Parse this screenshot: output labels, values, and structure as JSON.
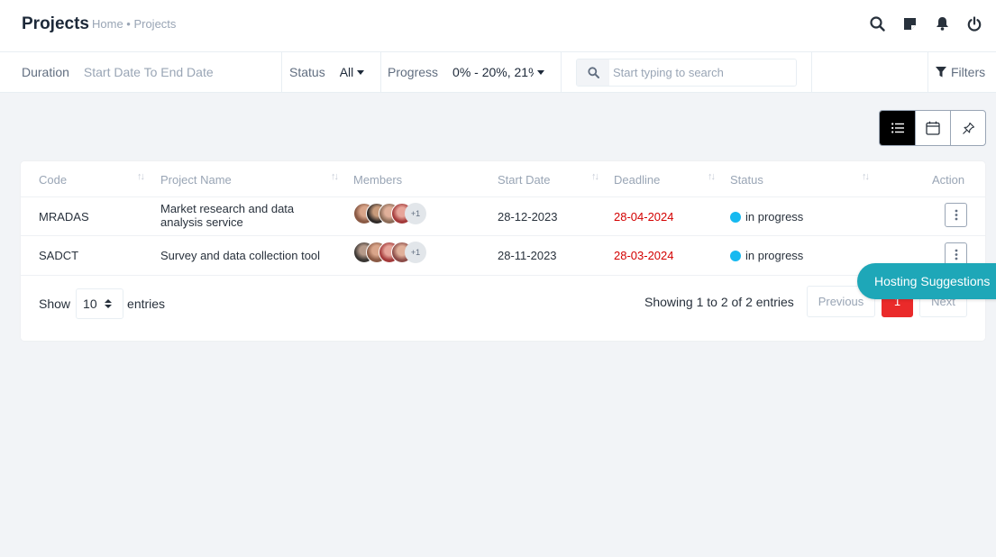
{
  "header": {
    "title": "Projects",
    "breadcrumb": "Home • Projects"
  },
  "top_icons": [
    "search-icon",
    "sticky-note-icon",
    "bell-icon",
    "power-icon"
  ],
  "filters": {
    "duration_label": "Duration",
    "duration_value": "Start Date To End Date",
    "status_label": "Status",
    "status_value": "All",
    "progress_label": "Progress",
    "progress_value": "0% - 20%, 21%",
    "search_placeholder": "Start typing to search",
    "filters_label": "Filters"
  },
  "view_modes": [
    "list-view-icon",
    "calendar-view-icon",
    "pin-view-icon"
  ],
  "table": {
    "headers": {
      "code": "Code",
      "name": "Project Name",
      "members": "Members",
      "start": "Start Date",
      "deadline": "Deadline",
      "status": "Status",
      "action": "Action"
    },
    "rows": [
      {
        "code": "MRADAS",
        "name": "Market research and data analysis service",
        "members_extra": "+1",
        "start": "28-12-2023",
        "deadline": "28-04-2024",
        "status": "in progress"
      },
      {
        "code": "SADCT",
        "name": "Survey and data collection tool",
        "members_extra": "+1",
        "start": "28-11-2023",
        "deadline": "28-03-2024",
        "status": "in progress"
      }
    ]
  },
  "footer": {
    "show_label": "Show",
    "page_length": "10",
    "entries_label": "entries",
    "info": "Showing 1 to 2 of 2 entries",
    "previous": "Previous",
    "current_page": "1",
    "next": "Next"
  },
  "floating": {
    "hosting_label": "Hosting Suggestions"
  },
  "colors": {
    "accent": "#1ea7b8",
    "danger": "#d30000",
    "status_dot": "#16b9f0",
    "active_page": "#ea2a2a"
  }
}
